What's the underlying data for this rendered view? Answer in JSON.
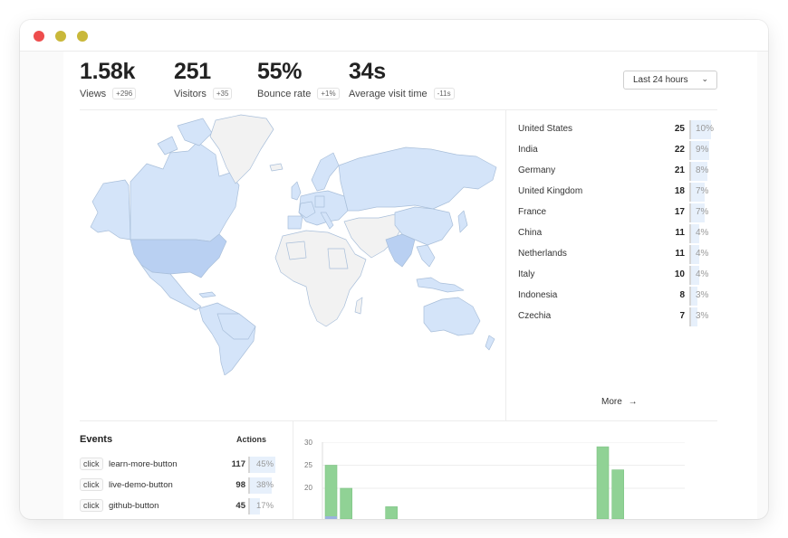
{
  "window": {
    "dots": [
      "#ee4d4d",
      "#c9b83a",
      "#c9b83a"
    ]
  },
  "stats": [
    {
      "value": "1.58k",
      "label": "Views",
      "change": "+296"
    },
    {
      "value": "251",
      "label": "Visitors",
      "change": "+35"
    },
    {
      "value": "55%",
      "label": "Bounce rate",
      "change": "+1%"
    },
    {
      "value": "34s",
      "label": "Average visit time",
      "change": "-11s"
    }
  ],
  "range_select": {
    "value": "Last 24 hours"
  },
  "countries": [
    {
      "name": "United States",
      "count": "25",
      "pct": "10%",
      "share": 10
    },
    {
      "name": "India",
      "count": "22",
      "pct": "9%",
      "share": 9
    },
    {
      "name": "Germany",
      "count": "21",
      "pct": "8%",
      "share": 8
    },
    {
      "name": "United Kingdom",
      "count": "18",
      "pct": "7%",
      "share": 7
    },
    {
      "name": "France",
      "count": "17",
      "pct": "7%",
      "share": 7
    },
    {
      "name": "China",
      "count": "11",
      "pct": "4%",
      "share": 4
    },
    {
      "name": "Netherlands",
      "count": "11",
      "pct": "4%",
      "share": 4
    },
    {
      "name": "Italy",
      "count": "10",
      "pct": "4%",
      "share": 4
    },
    {
      "name": "Indonesia",
      "count": "8",
      "pct": "3%",
      "share": 3
    },
    {
      "name": "Czechia",
      "count": "7",
      "pct": "3%",
      "share": 3
    }
  ],
  "more_label": "More",
  "events": {
    "title": "Events",
    "actions_label": "Actions",
    "rows": [
      {
        "type": "click",
        "name": "learn-more-button",
        "count": "117",
        "pct": "45%",
        "share": 45
      },
      {
        "type": "click",
        "name": "live-demo-button",
        "count": "98",
        "pct": "38%",
        "share": 38
      },
      {
        "type": "click",
        "name": "github-button",
        "count": "45",
        "pct": "17%",
        "share": 17
      }
    ]
  },
  "chart_data": {
    "type": "bar",
    "yticks": [
      "30",
      "25",
      "20"
    ],
    "ylim_visible": [
      15,
      30
    ],
    "colors": {
      "events": "#90d295",
      "lower": "#9ab2de"
    },
    "bars": [
      {
        "index": 0,
        "value": 25
      },
      {
        "index": 1,
        "value": 20
      },
      {
        "index": 4,
        "value": 16
      },
      {
        "index": 18,
        "value": 29
      },
      {
        "index": 19,
        "value": 24
      }
    ],
    "slots": 24
  },
  "map": {
    "fill_light": "#f2f2f2",
    "fill_blue": "#d4e4f9",
    "fill_mid": "#b9d0f2",
    "stroke": "#a9bfda"
  }
}
